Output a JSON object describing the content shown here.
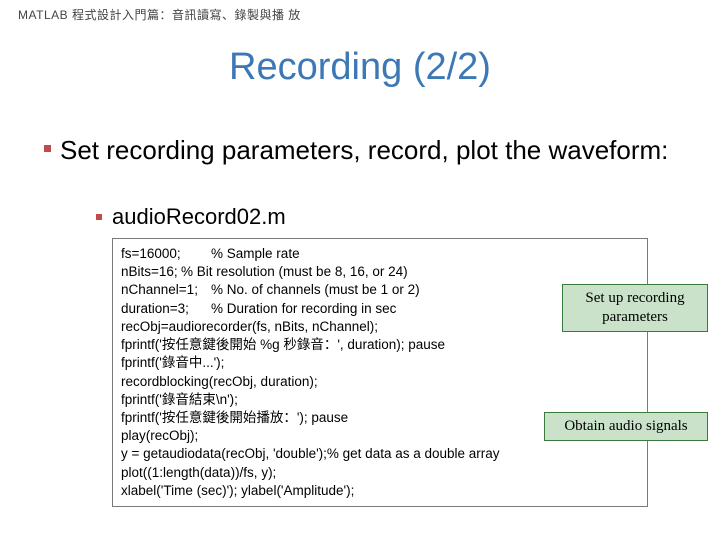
{
  "header": "MATLAB 程式設計入門篇：音訊讀寫、錄製與播 放",
  "title": "Recording (2/2)",
  "bullet_main": "Set recording parameters, record, plot the waveform:",
  "bullet_sub": "audioRecord02.m",
  "code": "fs=16000;\t% Sample rate\nnBits=16;\t% Bit resolution (must be 8, 16, or 24)\nnChannel=1;\t% No. of channels (must be 1 or 2)\nduration=3;\t% Duration for recording in sec\nrecObj=audiorecorder(fs, nBits, nChannel);\nfprintf('按任意鍵後開始 %g 秒錄音：', duration); pause\nfprintf('錄音中...');\nrecordblocking(recObj, duration);\nfprintf('錄音結束\\n');\nfprintf('按任意鍵後開始播放：'); pause\nplay(recObj);\ny = getaudiodata(recObj, 'double');% get data as a double array\nplot((1:length(data))/fs, y);\nxlabel('Time (sec)'); ylabel('Amplitude');",
  "callouts": {
    "setup": "Set up recording parameters",
    "obtain": "Obtain audio signals"
  }
}
